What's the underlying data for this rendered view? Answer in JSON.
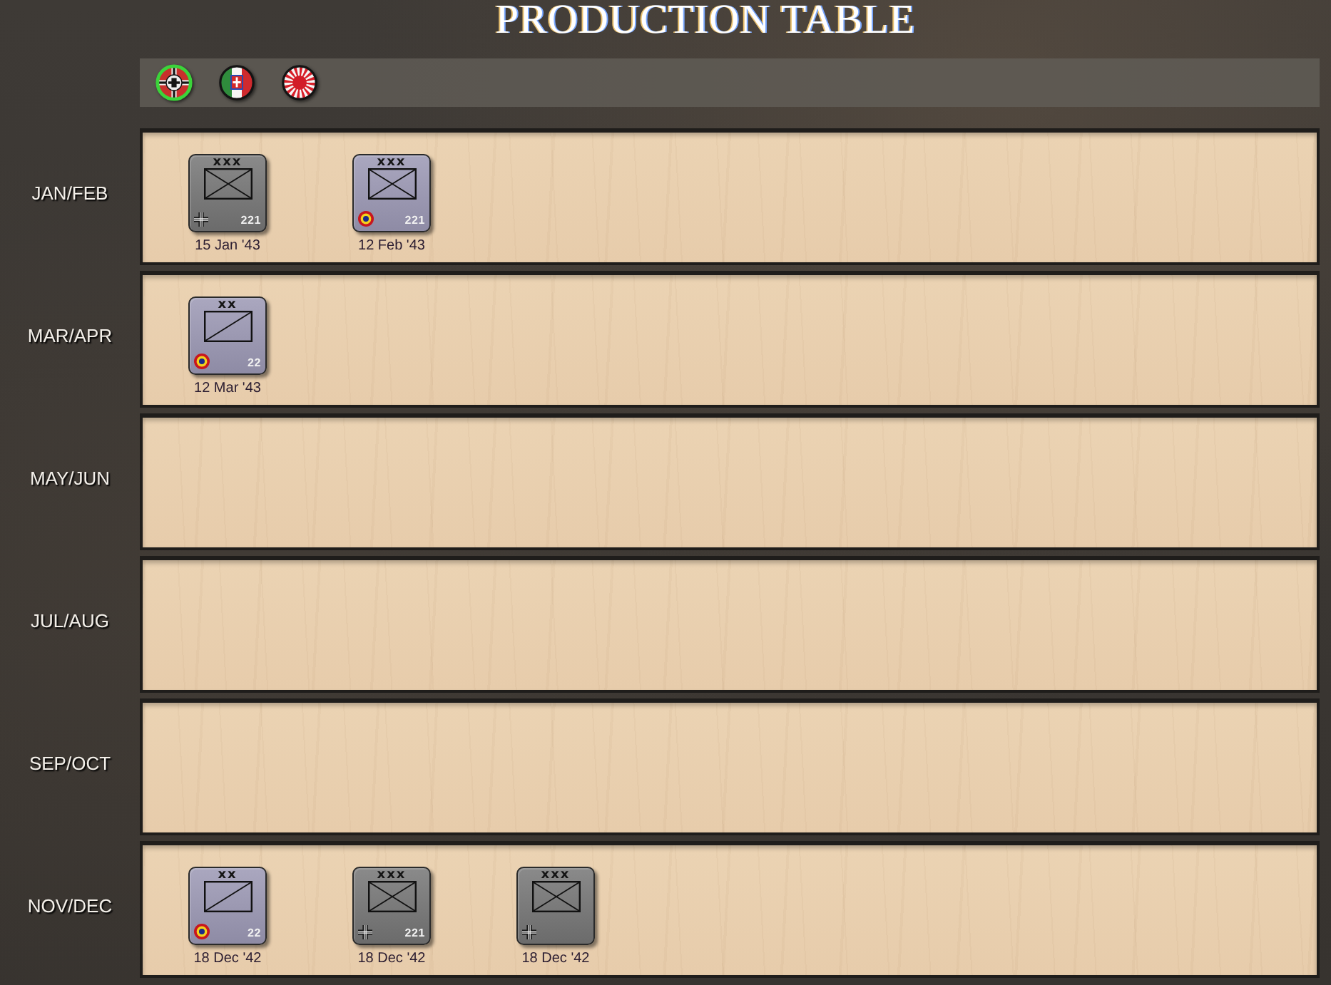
{
  "title": "PRODUCTION TABLE",
  "factions": [
    {
      "kind": "german",
      "selected": true
    },
    {
      "kind": "italian",
      "selected": false
    },
    {
      "kind": "japanese",
      "selected": false
    }
  ],
  "periods": [
    {
      "label": "JAN/FEB",
      "units": [
        {
          "kind": "infantry",
          "emblem": {
            "kind": "cross"
          },
          "echelon": "xxx",
          "strength": "221",
          "date": "15 Jan '43"
        },
        {
          "kind": "infantry",
          "emblem": {
            "kind": "roundel"
          },
          "echelon": "xxx",
          "strength": "221",
          "date": "12 Feb '43"
        }
      ]
    },
    {
      "label": "MAR/APR",
      "units": [
        {
          "kind": "cavalry",
          "emblem": {
            "kind": "roundel"
          },
          "echelon": "xx",
          "strength": "22",
          "date": "12 Mar '43"
        }
      ]
    },
    {
      "label": "MAY/JUN"
    },
    {
      "label": "JUL/AUG"
    },
    {
      "label": "SEP/OCT"
    },
    {
      "label": "NOV/DEC",
      "units": [
        {
          "kind": "cavalry",
          "emblem": {
            "kind": "roundel"
          },
          "echelon": "xx",
          "strength": "22",
          "date": "18 Dec '42"
        },
        {
          "kind": "infantry",
          "emblem": {
            "kind": "cross"
          },
          "echelon": "xxx",
          "strength": "221",
          "date": "18 Dec '42"
        },
        {
          "kind": "infantry",
          "emblem": {
            "kind": "cross"
          },
          "echelon": "xxx",
          "date": "18 Dec '42"
        }
      ]
    }
  ]
}
